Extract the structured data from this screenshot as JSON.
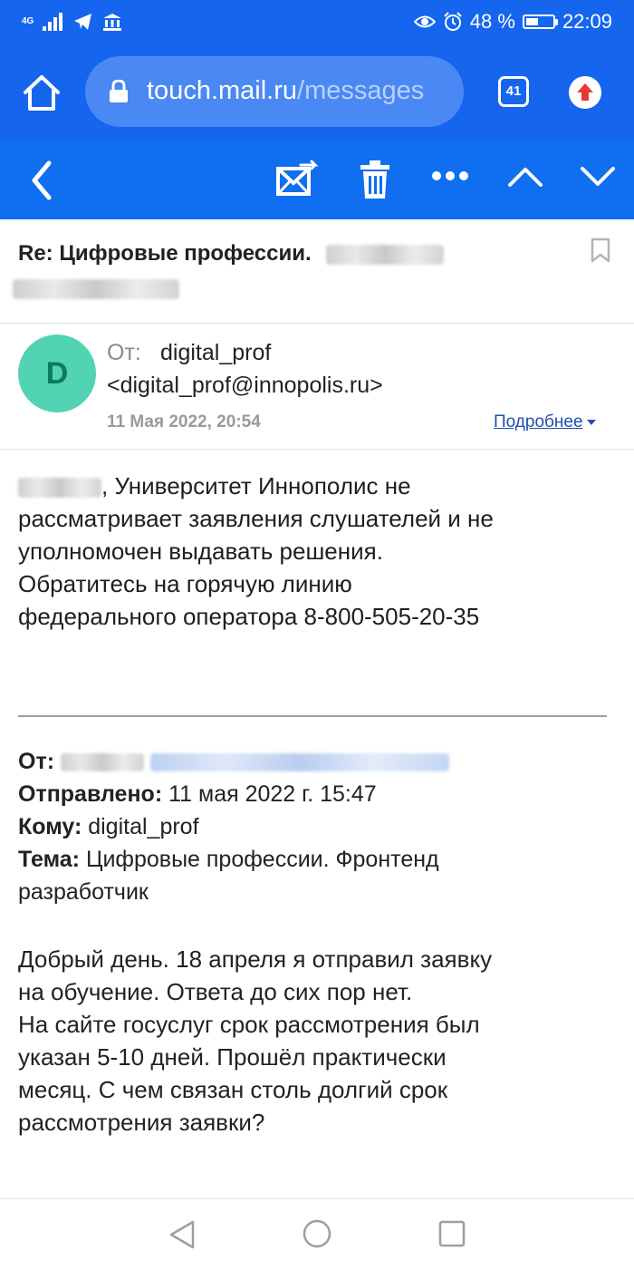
{
  "status_bar": {
    "network_type": "4G",
    "battery_text": "48 %",
    "battery_level": 0.48,
    "time": "22:09"
  },
  "browser": {
    "url_host": "touch.mail.ru",
    "url_path": "/messages",
    "tab_count": "41"
  },
  "toolbar": {
    "icons": [
      "back-icon",
      "move-mail-icon",
      "trash-icon",
      "more-icon",
      "chevron-up-icon",
      "chevron-down-icon"
    ]
  },
  "message": {
    "subject": "Re: Цифровые профессии.",
    "from_label": "От:",
    "from_name": "digital_prof",
    "from_email": "<digital_prof@innopolis.ru>",
    "avatar_letter": "D",
    "date": "11 Мая 2022, 20:54",
    "details_link": "Подробнее",
    "body_lines": [
      ", Университет Иннополис не",
      "рассматривает заявления слушателей и не",
      "уполномочен выдавать решения.",
      "Обратитесь на горячую линию",
      "федерального оператора 8-800-505-20-35"
    ]
  },
  "quoted": {
    "from_label": "От:",
    "sent_label": "Отправлено:",
    "sent_value": "11 мая 2022 г. 15:47",
    "to_label": "Кому:",
    "to_value": "digital_prof",
    "subject_label": "Тема:",
    "subject_value": "Цифровые профессии. Фронтенд",
    "subject_value_2": "разработчик",
    "body_lines": [
      "Добрый день. 18 апреля я отправил заявку",
      "на обучение. Ответа до сих пор нет.",
      "На сайте госуслуг срок рассмотрения был",
      "указан 5-10 дней. Прошёл практически",
      "месяц. С чем связан столь долгий срок",
      "рассмотрения заявки?"
    ]
  },
  "colors": {
    "brand_blue": "#1565ef",
    "avatar_bg": "#52d3b3",
    "link": "#1f4fb5"
  }
}
